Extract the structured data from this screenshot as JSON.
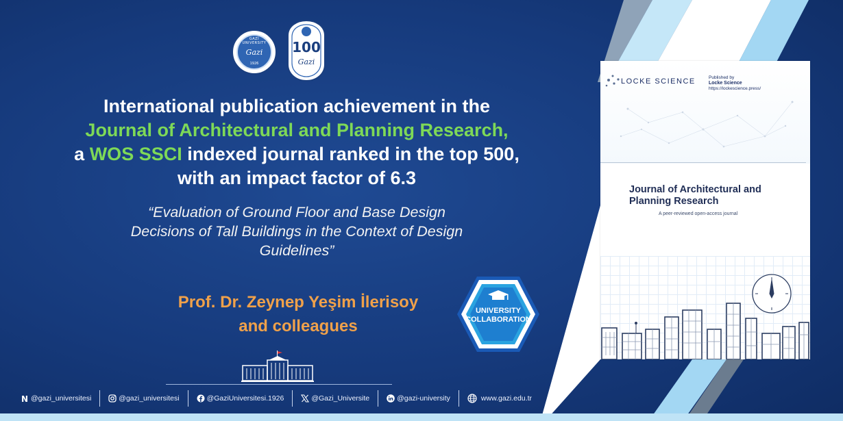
{
  "headline": {
    "line1": "International publication achievement in the",
    "line2": "Journal of Architectural and Planning Research,",
    "line3_a": "a ",
    "line3_green": "WOS SSCI",
    "line3_b": " indexed journal ranked in the top 500,",
    "line4": "with an impact factor of 6.3"
  },
  "quote": {
    "line1": "“Evaluation of Ground Floor and Base Design",
    "line2": "Decisions of Tall Buildings in the Context of Design",
    "line3": "Guidelines”"
  },
  "author": {
    "line1": "Prof. Dr. Zeynep Yeşim İlerisoy",
    "line2": "and colleagues"
  },
  "badge": {
    "line1": "UNIVERSITY",
    "line2": "COLLABORATION",
    "icon": "graduation-cap-icon"
  },
  "logos": {
    "gazi_ring": "GAZİ UNIVERSITY",
    "gazi_script": "Gazi",
    "gazi_year": "1926",
    "anniversary_number": "100",
    "anniversary_script": "Gazi"
  },
  "footer": {
    "items": [
      {
        "icon": "nsosyal-icon",
        "text": "@gazi_universitesi"
      },
      {
        "icon": "instagram-icon",
        "text": "@gazi_universitesi"
      },
      {
        "icon": "facebook-icon",
        "text": "@GaziUniversitesi.1926"
      },
      {
        "icon": "x-icon",
        "text": "@Gazi_Universite"
      },
      {
        "icon": "linkedin-icon",
        "text": "@gazi-university"
      },
      {
        "icon": "globe-icon",
        "text": "www.gazi.edu.tr"
      }
    ]
  },
  "cover": {
    "brand": "LOCKE SCIENCE",
    "published_by": "Published by",
    "publisher": "Locke Science",
    "publisher_url": "https://lockescience.press/",
    "title_line1": "Journal of Architectural and",
    "title_line2": "Planning Research",
    "subtitle": "A peer-reviewed open-access journal"
  },
  "colors": {
    "background": "#173a7a",
    "accent_green": "#7ed957",
    "accent_orange": "#f0a14a",
    "light_blue": "#bfe3f6"
  }
}
